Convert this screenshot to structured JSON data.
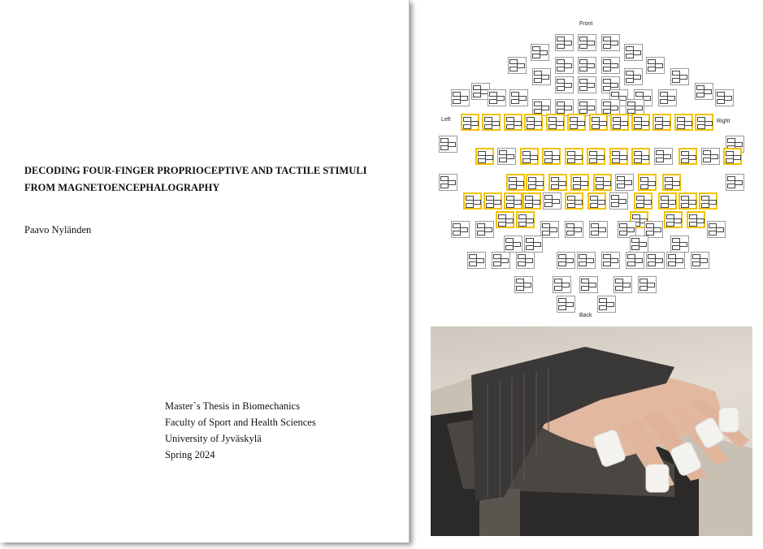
{
  "title_page": {
    "title": "DECODING FOUR-FINGER PROPRIOCEPTIVE AND TACTILE STIMULI FROM MAGNETOENCEPHALOGRAPHY",
    "author": "Paavo Nyländen",
    "thesis_type": "Master`s Thesis in Biomechanics",
    "faculty": "Faculty of Sport and Health Sciences",
    "university": "University of Jyväskylä",
    "date": "Spring 2024"
  },
  "sensor_layout": {
    "front": "Front",
    "back": "Back",
    "left": "Left",
    "right": "Right",
    "highlight_color": "#f2c200"
  }
}
